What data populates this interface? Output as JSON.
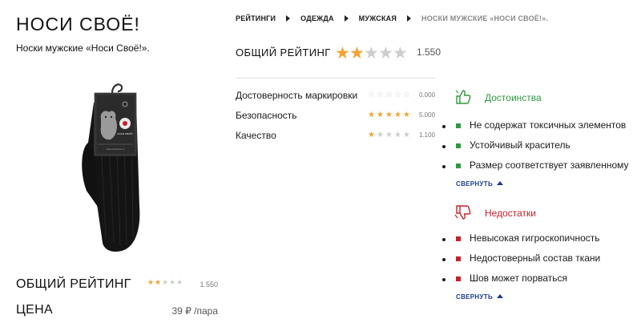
{
  "product": {
    "brand": "НОСИ СВОЁ!",
    "subtitle": "Носки мужские «Носи Своё!».",
    "image": "black-socks-product-photo",
    "package_label": "носи своё!",
    "package_url": "www.nosisvoe.ru"
  },
  "breadcrumb": [
    {
      "label": "РЕЙТИНГИ"
    },
    {
      "label": "ОДЕЖДА"
    },
    {
      "label": "МУЖСКАЯ"
    },
    {
      "label": "НОСКИ МУЖСКИЕ «НОСИ СВОЁ!»."
    }
  ],
  "overall_rating": {
    "label": "ОБЩИЙ РЕЙТИНГ",
    "value_text": "1.550",
    "value": 1.55,
    "max": 5
  },
  "criteria": [
    {
      "name": "Достоверность маркировки",
      "value_text": "0.000",
      "value": 0,
      "max": 5
    },
    {
      "name": "Безопасность",
      "value_text": "5.000",
      "value": 5,
      "max": 5
    },
    {
      "name": "Качество",
      "value_text": "1.100",
      "value": 1.1,
      "max": 5
    }
  ],
  "pros": {
    "title": "Достоинства",
    "icon": "thumbs-up-icon",
    "items": [
      "Не содержат токсичных элементов",
      "Устойчивый краситель",
      "Размер соответствует заявленному"
    ],
    "collapse_label": "СВЕРНУТЬ"
  },
  "cons": {
    "title": "Недостатки",
    "icon": "thumbs-down-icon",
    "items": [
      "Невысокая гигроскопичность",
      "Недостоверный состав ткани",
      "Шов может порваться"
    ],
    "collapse_label": "СВЕРНУТЬ"
  },
  "summary": {
    "rating_label": "ОБЩИЙ РЕЙТИНГ",
    "rating_value_text": "1.550",
    "rating_value": 1.55,
    "price_label": "ЦЕНА",
    "price_value": "39 ₽ /пара"
  },
  "colors": {
    "star_on": "#f3a331",
    "star_off": "#cdcdcd",
    "pros_green": "#2e9a3d",
    "cons_red": "#c8202a",
    "link_blue": "#1a3d8f"
  }
}
